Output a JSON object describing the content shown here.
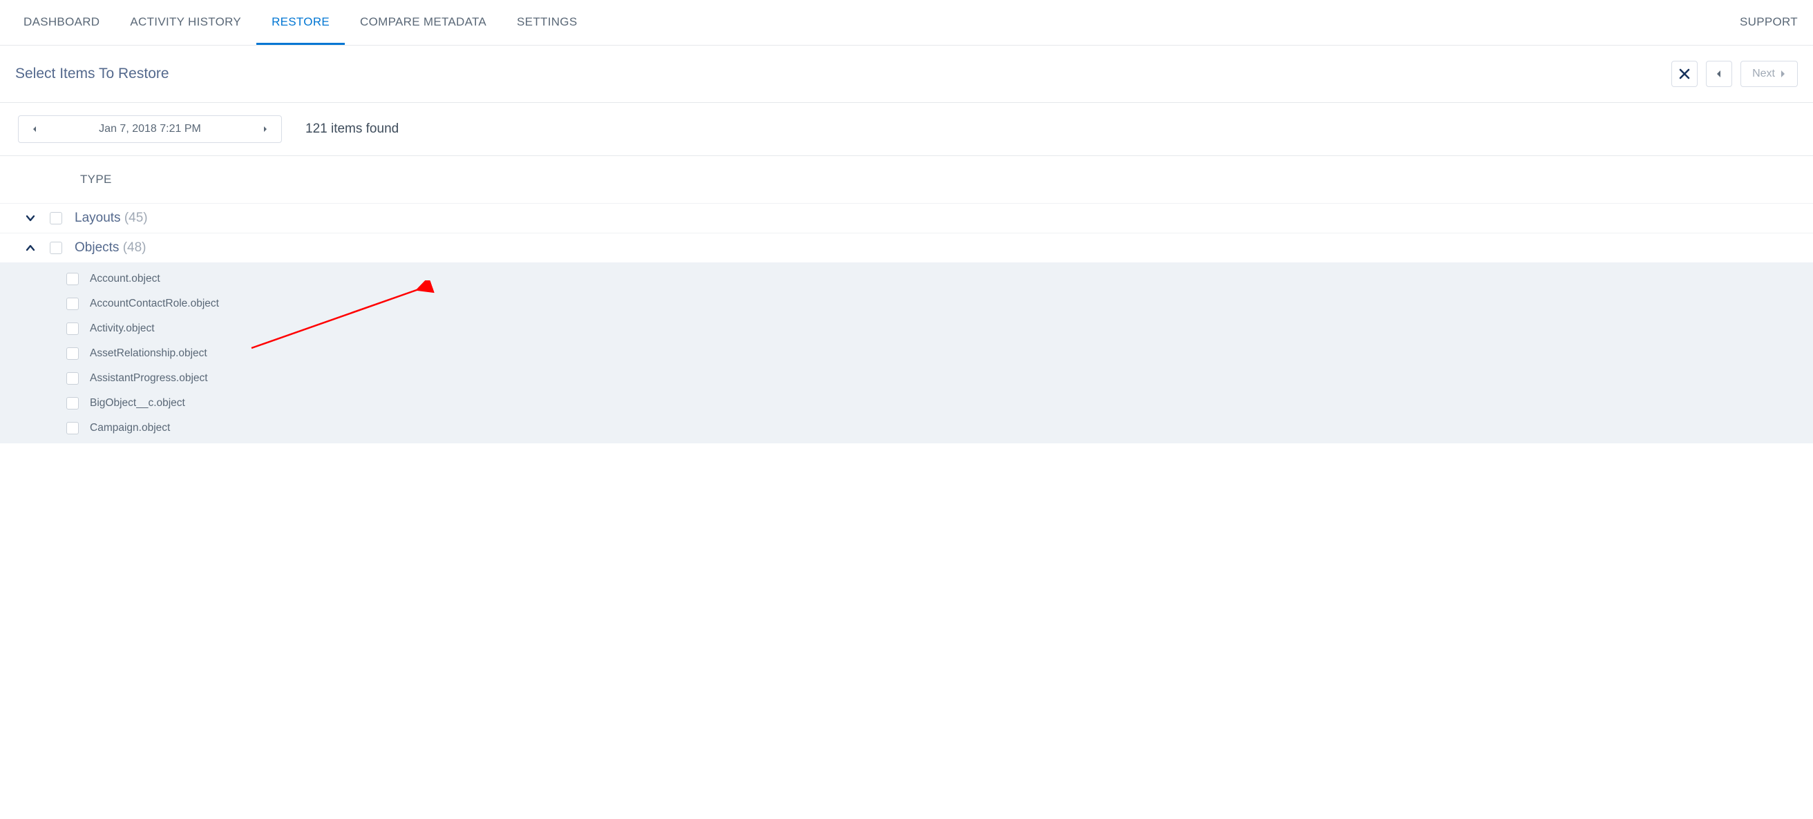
{
  "nav": {
    "items": [
      {
        "label": "DASHBOARD",
        "active": false
      },
      {
        "label": "ACTIVITY HISTORY",
        "active": false
      },
      {
        "label": "RESTORE",
        "active": true
      },
      {
        "label": "COMPARE METADATA",
        "active": false
      },
      {
        "label": "SETTINGS",
        "active": false
      }
    ],
    "support": "SUPPORT"
  },
  "subheader": {
    "title": "Select Items To Restore",
    "next_label": "Next"
  },
  "filter": {
    "date_text": "Jan 7, 2018 7:21 PM",
    "items_found": "121 items found"
  },
  "columns": {
    "type": "TYPE"
  },
  "groups": [
    {
      "name": "Layouts",
      "count": "(45)",
      "expanded": false,
      "items": []
    },
    {
      "name": "Objects",
      "count": "(48)",
      "expanded": true,
      "items": [
        "Account.object",
        "AccountContactRole.object",
        "Activity.object",
        "AssetRelationship.object",
        "AssistantProgress.object",
        "BigObject__c.object",
        "Campaign.object"
      ]
    }
  ]
}
